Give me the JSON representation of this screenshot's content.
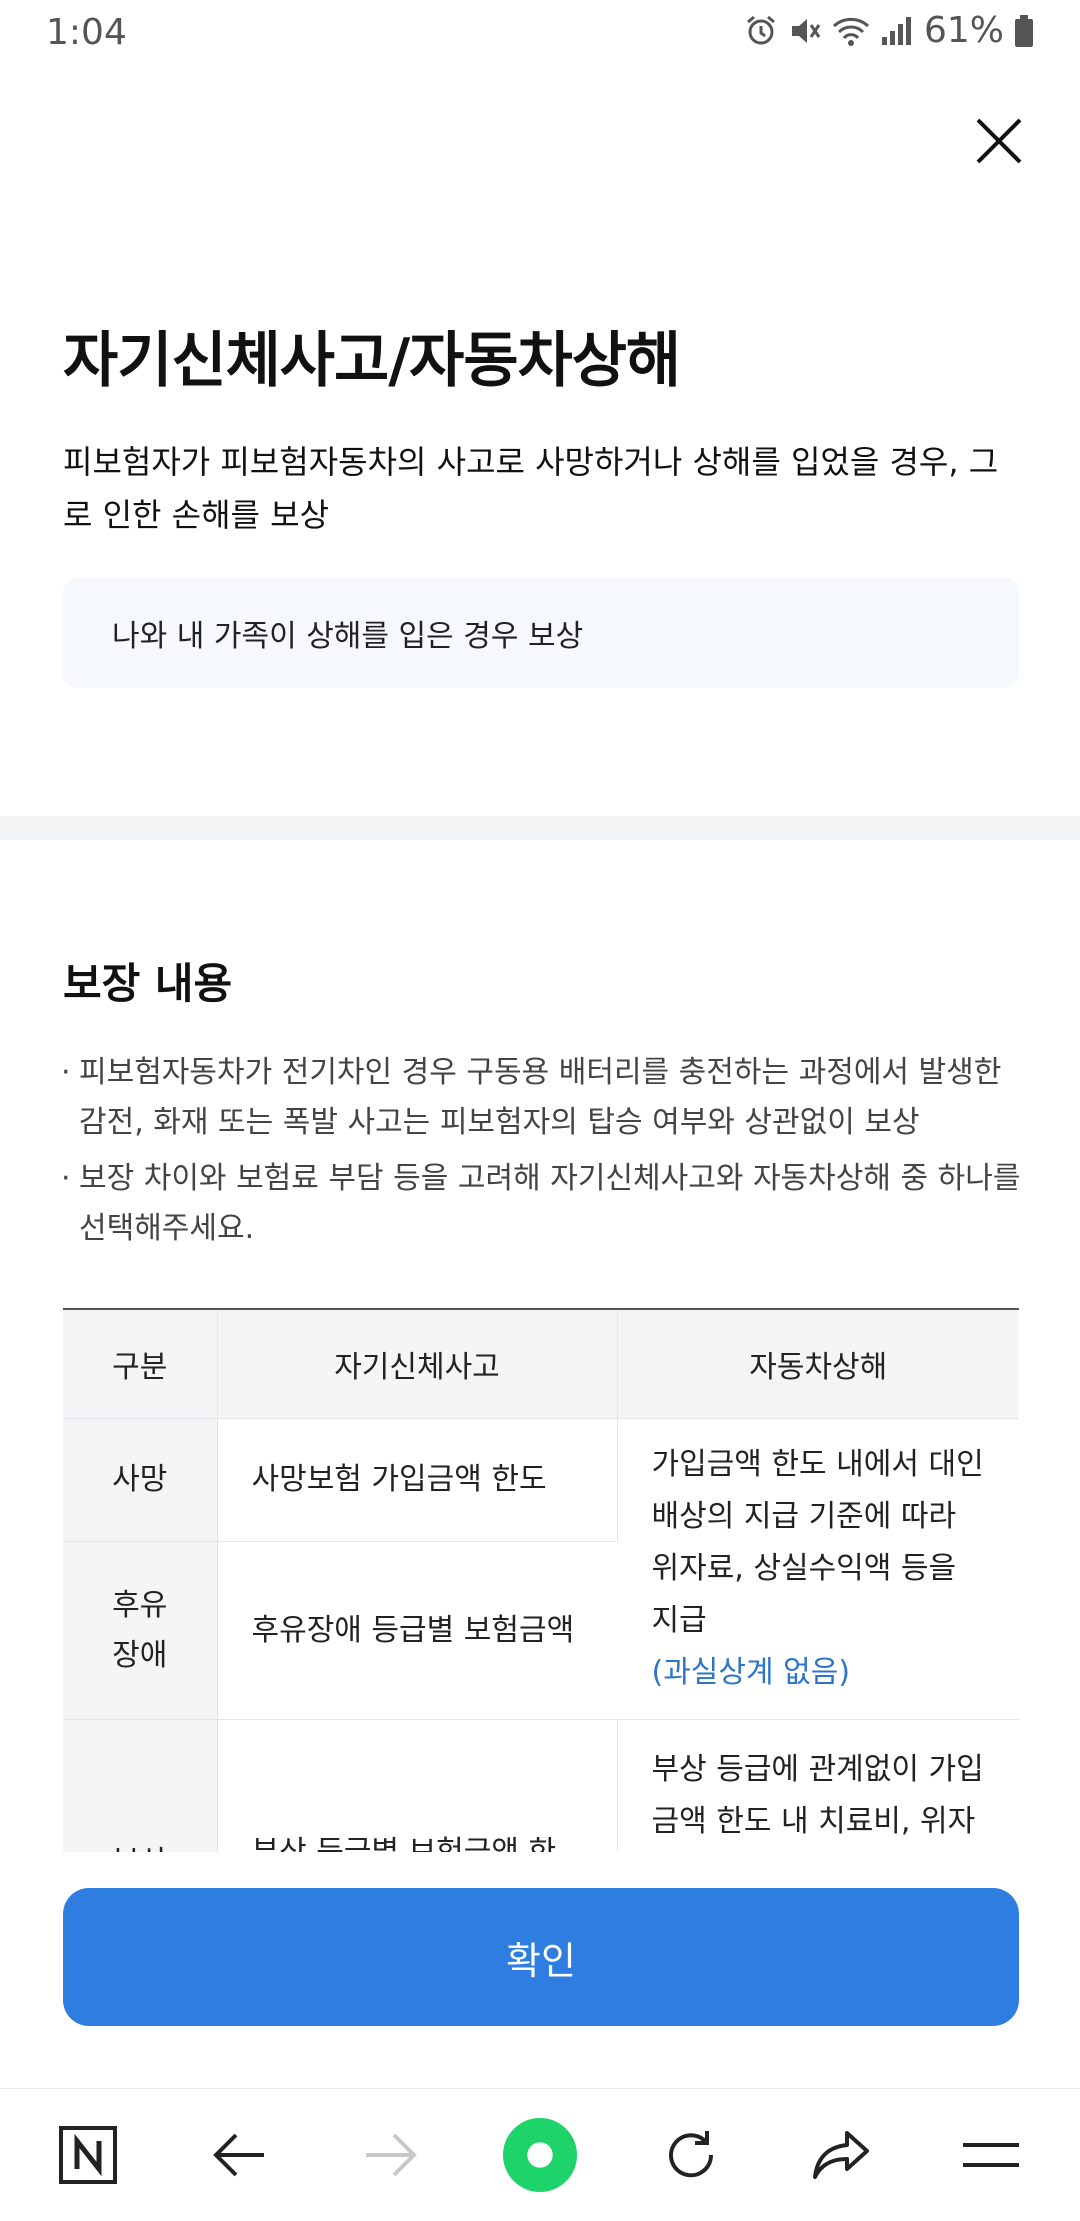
{
  "status": {
    "time": "1:04",
    "battery": "61%"
  },
  "modal": {
    "title": "자기신체사고/자동차상해",
    "description": "피보험자가 피보험자동차의 사고로 사망하거나 상해를 입었을 경우, 그로 인한 손해를 보상",
    "note": "나와 내 가족이 상해를 입은 경우 보상"
  },
  "coverage": {
    "heading": "보장 내용",
    "bullets": [
      "피보험자동차가 전기차인 경우 구동용 배터리를 충전하는 과정에서 발생한 감전, 화재 또는 폭발 사고는 피보험자의 탑승 여부와 상관없이 보상",
      "보장 차이와 보험료 부담 등을 고려해 자기신체사고와 자동차상해 중 하나를 선택해주세요."
    ],
    "table": {
      "headers": [
        "구분",
        "자기신체사고",
        "자동차상해"
      ],
      "rows": {
        "death_label": "사망",
        "death_a": "사망보험 가입금액 한도",
        "disability_label_1": "후유",
        "disability_label_2": "장애",
        "disability_a": "후유장애 등급별 보험금액",
        "merged_b": "가입금액 한도 내에서 대인배상의 지급 기준에 따라 위자료, 상실수익액 등을 지급",
        "merged_b_note": "(과실상계 없음)",
        "injury_label": "부상",
        "injury_a": "부상 등급별 보험금액 한도 내 실제 치료비",
        "injury_b": "부상 등급에 관계없이 가입금액 한도 내 치료비, 위자료, 휴업손해 등 지급"
      }
    }
  },
  "confirm_label": "확인",
  "navbar": {
    "items": [
      "n-logo-icon",
      "back-arrow-icon",
      "forward-arrow-icon",
      "home-dot-icon",
      "refresh-icon",
      "share-icon",
      "menu-icon"
    ]
  }
}
